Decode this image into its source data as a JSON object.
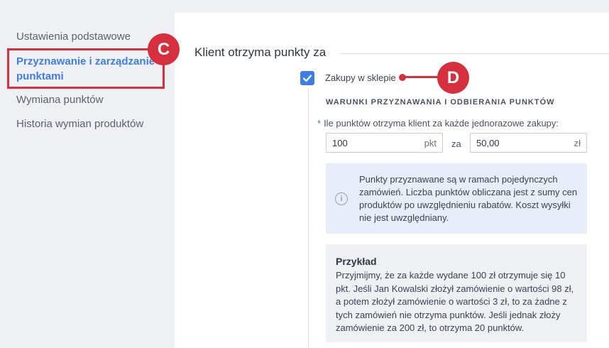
{
  "sidebar": {
    "items": [
      {
        "label": "Ustawienia podstawowe"
      },
      {
        "label": "Przyznawanie i zarządzanie punktami",
        "line1": "Przyznawanie i zarządzanie",
        "line2": "punktami"
      },
      {
        "label": "Wymiana punktów"
      },
      {
        "label": "Historia wymian produktów"
      }
    ]
  },
  "annotations": {
    "c": "C",
    "d": "D"
  },
  "main": {
    "section_title": "Klient otrzyma punkty za",
    "checkbox_label": "Zakupy w sklepie",
    "checkbox_checked": true,
    "subheading": "WARUNKI PRZYZNAWANIA I ODBIERANIA PUNKTÓW",
    "field_required_mark": "*",
    "field_label": "Ile punktów otrzyma klient za każde jednorazowe zakupy:",
    "points_value": "100",
    "points_unit": "pkt",
    "za_label": "za",
    "amount_value": "50,00",
    "amount_unit": "zł",
    "info_text": "Punkty przyznawane są w ramach pojedynczych zamówień. Liczba punktów obliczana jest z sumy cen produktów po uwzględnieniu rabatów. Koszt wysyłki nie jest uwzględniany.",
    "example_title": "Przykład",
    "example_text": "Przyjmijmy, że za każde wydane 100 zł otrzymuje się 10 pkt. Jeśli Jan Kowalski złożył zamówienie o wartości 98 zł, a potem złożył zamówienie o wartości 3 zł, to za żadne z tych zamówień nie otrzyma punktów. Jeśli jednak złoży zamówienie za 200 zł, to otrzyma 20 punktów."
  },
  "colors": {
    "accent": "#3f7de3",
    "annotation": "#d6303f",
    "sidebar_bg": "#eff0f4",
    "info_bg": "#e7edf9"
  },
  "icons": {
    "checkbox": "check-icon",
    "info": "info-icon"
  }
}
